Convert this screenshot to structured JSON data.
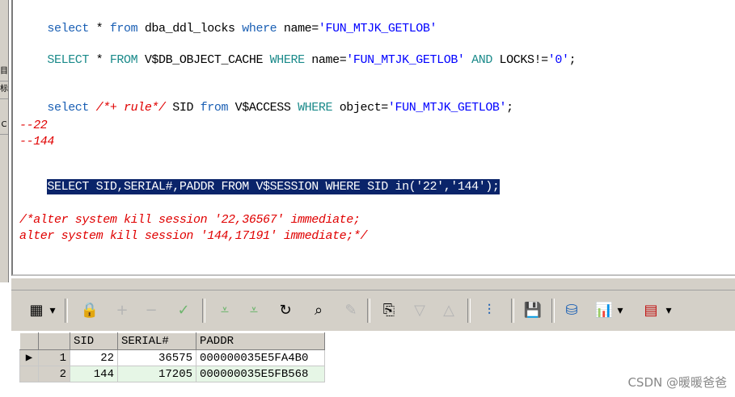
{
  "left_strip": [
    "目",
    "标",
    "C"
  ],
  "editor": {
    "line1": {
      "kw1": "select",
      "star": " * ",
      "kw2": "from",
      "obj": " dba_ddl_locks ",
      "kw3": "where",
      "cond": " name=",
      "str": "'FUN_MTJK_GETLOB'"
    },
    "line2": {
      "kw1": "SELECT",
      "star": " * ",
      "kw2": "FROM",
      "obj": " V$DB_OBJECT_CACHE ",
      "kw3": "WHERE",
      "cond": " name=",
      "str": "'FUN_MTJK_GETLOB'",
      "kw4": " AND ",
      "tail": "LOCKS!=",
      "str2": "'0'",
      "end": ";"
    },
    "line3": {
      "kw1": "select",
      "hint": " /*+ rule*/",
      "cols": " SID ",
      "kw2": "from",
      "obj": " V$ACCESS ",
      "kw3": "WHERE",
      "cond": " object=",
      "str": "'FUN_MTJK_GETLOB'",
      "end": ";"
    },
    "comment1": "--22",
    "comment2": "--144",
    "selected": "SELECT SID,SERIAL#,PADDR FROM V$SESSION WHERE SID in('22','144');",
    "block_comment1": "/*alter system kill session '22,36567' immediate;",
    "block_comment2": "alter system kill session '144,17191' immediate;*/"
  },
  "toolbar": {
    "grid_icon": "▦",
    "dropdown": "▾",
    "lock_icon": "🔒",
    "plus": "+",
    "minus": "−",
    "check": "✓",
    "down_double": "⩡",
    "down_double2": "⩡",
    "refresh": "↻",
    "find": "⌕",
    "clear": "✎",
    "export_icon": "⎘",
    "nav_down": "▽",
    "nav_up": "△",
    "tree_icon": "⫶",
    "save_icon": "💾",
    "db_icon": "⛁",
    "chart_icon": "📊",
    "table_icon": "▤"
  },
  "grid": {
    "columns": [
      "SID",
      "SERIAL#",
      "PADDR"
    ],
    "rows": [
      {
        "num": "1",
        "sid": "22",
        "serial": "36575",
        "paddr": "000000035E5FA4B0"
      },
      {
        "num": "2",
        "sid": "144",
        "serial": "17205",
        "paddr": "000000035E5FB568"
      }
    ],
    "row_indicator": "▶"
  },
  "watermark": "CSDN @暖暖爸爸"
}
